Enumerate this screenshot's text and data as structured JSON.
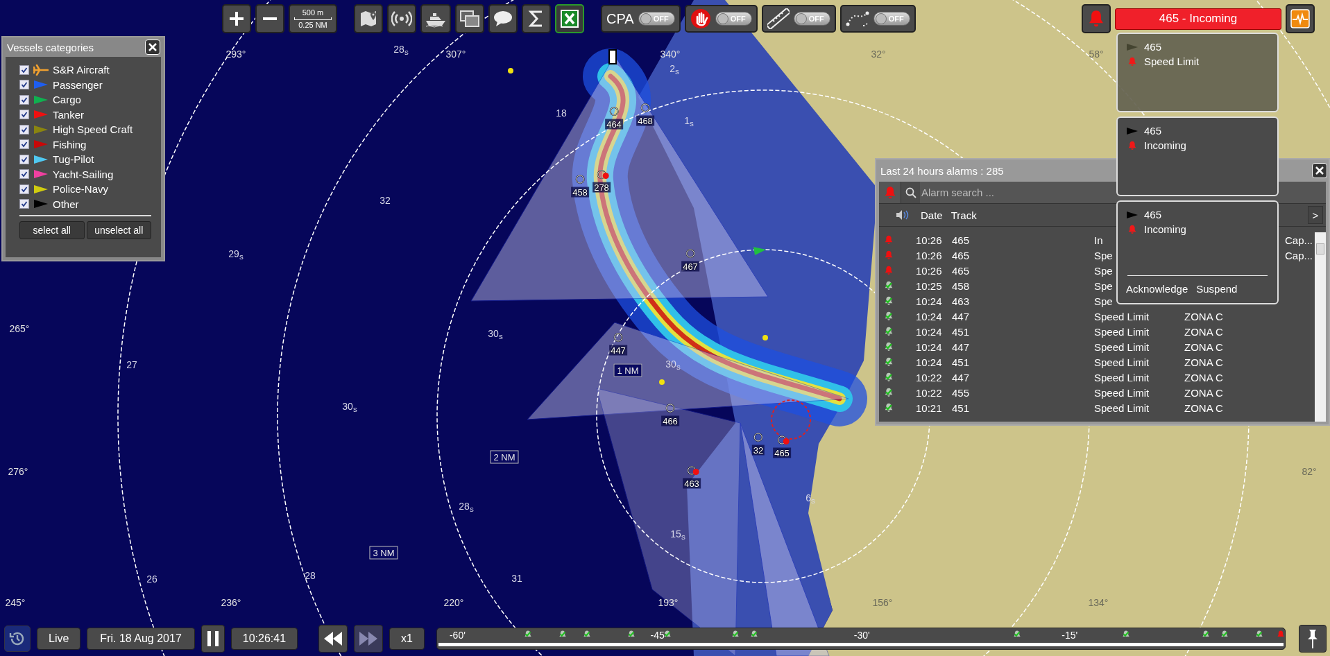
{
  "toolbar": {
    "scale": {
      "metric": "500 m",
      "nautical": "0.25 NM"
    },
    "toggles": [
      {
        "kind": "text",
        "label": "CPA",
        "on": false,
        "state_label": "OFF"
      },
      {
        "kind": "stop-hand",
        "on": false,
        "state_label": "OFF"
      },
      {
        "kind": "ruler",
        "on": false,
        "state_label": "OFF"
      },
      {
        "kind": "route",
        "on": false,
        "state_label": "OFF"
      }
    ]
  },
  "alarm_banner": "465 - Incoming",
  "notifications": [
    {
      "track": "465",
      "alarm": "Speed Limit",
      "dimmed": true
    },
    {
      "track": "465",
      "alarm": "Incoming",
      "dimmed": false
    },
    {
      "track": "465",
      "alarm": "Incoming",
      "dimmed": false,
      "actions": [
        "Acknowledge",
        "Suspend"
      ]
    }
  ],
  "vessel_categories": {
    "title": "Vessels categories",
    "items": [
      {
        "label": "S&R Aircraft",
        "kind": "plane",
        "color": "#f0a030",
        "checked": true
      },
      {
        "label": "Passenger",
        "kind": "flag",
        "color": "#1e5ef0",
        "checked": true
      },
      {
        "label": "Cargo",
        "kind": "flag",
        "color": "#10b050",
        "checked": true
      },
      {
        "label": "Tanker",
        "kind": "flag",
        "color": "#f01010",
        "checked": true
      },
      {
        "label": "High Speed Craft",
        "kind": "flag",
        "color": "#8a8410",
        "checked": true
      },
      {
        "label": "Fishing",
        "kind": "flag",
        "color": "#c80808",
        "checked": true
      },
      {
        "label": "Tug-Pilot",
        "kind": "flag",
        "color": "#50c8f0",
        "checked": true
      },
      {
        "label": "Yacht-Sailing",
        "kind": "flag",
        "color": "#f040a0",
        "checked": true
      },
      {
        "label": "Police-Navy",
        "kind": "flag",
        "color": "#d0cc10",
        "checked": true
      },
      {
        "label": "Other",
        "kind": "flag",
        "color": "#000000",
        "checked": true
      }
    ],
    "buttons": [
      "select all",
      "unselect all"
    ]
  },
  "map": {
    "bearings": [
      "293°",
      "307°",
      "340°",
      "32°",
      "58°",
      "265°",
      "276°",
      "82°",
      "245°",
      "236°",
      "220°",
      "193°",
      "156°",
      "134°"
    ],
    "soundings": [
      "28$_{s}$",
      "18",
      "2$_{s}$",
      "1$_{s}$",
      "32",
      "29$_{s}$",
      "30$_{s}$",
      "27",
      "30$_{s}$",
      "30$_{s}$",
      "28$_{s}$",
      "15$_{s}$",
      "6$_{s}$",
      "26",
      "28",
      "31"
    ],
    "range_labels": [
      "1 NM",
      "2 NM",
      "3 NM"
    ],
    "tracks": [
      {
        "label": "464",
        "alarm": false
      },
      {
        "label": "468",
        "alarm": false
      },
      {
        "label": "458",
        "alarm": false
      },
      {
        "label": "278",
        "alarm": true
      },
      {
        "label": "467",
        "alarm": false
      },
      {
        "label": "447",
        "alarm": false
      },
      {
        "label": "466",
        "alarm": false
      },
      {
        "label": "32",
        "alarm": false
      },
      {
        "label": "465",
        "alarm": true
      },
      {
        "label": "463",
        "alarm": true
      }
    ]
  },
  "alarms": {
    "title": "Last 24 hours alarms : 285",
    "search": {
      "placeholder": "Alarm search ..."
    },
    "columns": [
      "Date",
      "Track"
    ],
    "more": ">",
    "rows": [
      {
        "acknowledged": false,
        "time": "10:26",
        "track": "465",
        "type": "In",
        "extra": "Cap..."
      },
      {
        "acknowledged": false,
        "time": "10:26",
        "track": "465",
        "type": "Spe",
        "extra": "Cap..."
      },
      {
        "acknowledged": false,
        "time": "10:26",
        "track": "465",
        "type": "Spe"
      },
      {
        "acknowledged": true,
        "time": "10:25",
        "track": "458",
        "type": "Spe"
      },
      {
        "acknowledged": true,
        "time": "10:24",
        "track": "463",
        "type": "Spe"
      },
      {
        "acknowledged": true,
        "time": "10:24",
        "track": "447",
        "type": "Speed Limit",
        "zone": "ZONA C"
      },
      {
        "acknowledged": true,
        "time": "10:24",
        "track": "451",
        "type": "Speed Limit",
        "zone": "ZONA C"
      },
      {
        "acknowledged": true,
        "time": "10:24",
        "track": "447",
        "type": "Speed Limit",
        "zone": "ZONA C"
      },
      {
        "acknowledged": true,
        "time": "10:24",
        "track": "451",
        "type": "Speed Limit",
        "zone": "ZONA C"
      },
      {
        "acknowledged": true,
        "time": "10:22",
        "track": "447",
        "type": "Speed Limit",
        "zone": "ZONA C"
      },
      {
        "acknowledged": true,
        "time": "10:22",
        "track": "455",
        "type": "Speed Limit",
        "zone": "ZONA C"
      },
      {
        "acknowledged": true,
        "time": "10:21",
        "track": "451",
        "type": "Speed Limit",
        "zone": "ZONA C"
      }
    ]
  },
  "playback": {
    "mode": "Live",
    "date": "Fri. 18 Aug 2017",
    "time": "10:26:41",
    "speed": "x1",
    "timeline": {
      "labels": [
        "-60'",
        "-45'",
        "-30'",
        "-15'"
      ],
      "markers": [
        {
          "acknowledged": true
        },
        {
          "acknowledged": true
        },
        {
          "acknowledged": true
        },
        {
          "acknowledged": true
        },
        {
          "acknowledged": true
        },
        {
          "acknowledged": true
        },
        {
          "acknowledged": true
        },
        {
          "acknowledged": true
        },
        {
          "acknowledged": true
        },
        {
          "acknowledged": true
        },
        {
          "acknowledged": true
        },
        {
          "acknowledged": true
        },
        {
          "acknowledged": false
        }
      ]
    }
  }
}
